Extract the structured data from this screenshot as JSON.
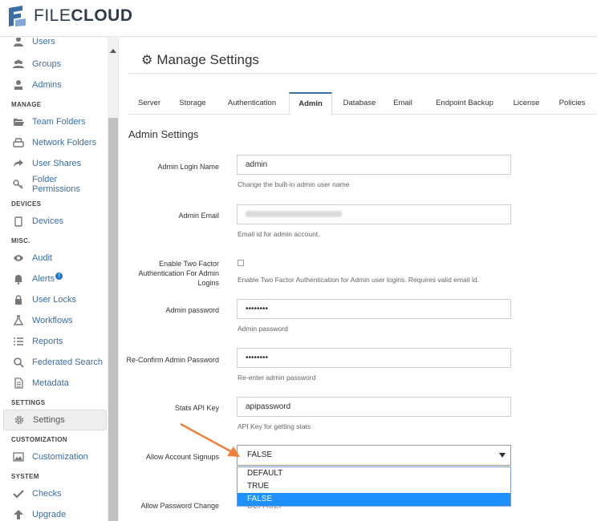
{
  "app": {
    "logo_text_light": "FILE",
    "logo_text_bold": "CLOUD",
    "brand_color": "#3a6ea5"
  },
  "sidebar": {
    "items": [
      {
        "label": "Users",
        "icon": "user-icon"
      },
      {
        "label": "Groups",
        "icon": "users-icon"
      },
      {
        "label": "Admins",
        "icon": "admin-icon"
      },
      {
        "label": "Team Folders",
        "icon": "folder-open-icon"
      },
      {
        "label": "Network Folders",
        "icon": "hdd-icon"
      },
      {
        "label": "User Shares",
        "icon": "share-icon"
      },
      {
        "label": "Folder Permissions",
        "icon": "key-icon"
      },
      {
        "label": "Devices",
        "icon": "device-icon"
      },
      {
        "label": "Audit",
        "icon": "eye-icon"
      },
      {
        "label": "Alerts",
        "icon": "bell-icon"
      },
      {
        "label": "User Locks",
        "icon": "lock-icon"
      },
      {
        "label": "Workflows",
        "icon": "flask-icon"
      },
      {
        "label": "Reports",
        "icon": "list-icon"
      },
      {
        "label": "Federated Search",
        "icon": "search-icon"
      },
      {
        "label": "Metadata",
        "icon": "file-icon"
      },
      {
        "label": "Settings",
        "icon": "gear-icon"
      },
      {
        "label": "Customization",
        "icon": "image-icon"
      },
      {
        "label": "Checks",
        "icon": "check-icon"
      },
      {
        "label": "Upgrade",
        "icon": "arrow-up-icon"
      }
    ],
    "headers": [
      "MANAGE",
      "DEVICES",
      "MISC.",
      "SETTINGS",
      "CUSTOMIZATION",
      "SYSTEM"
    ],
    "alerts_badge": "!"
  },
  "page": {
    "title": "Manage Settings",
    "section_title": "Admin Settings"
  },
  "tabs": [
    {
      "label": "Server"
    },
    {
      "label": "Storage"
    },
    {
      "label": "Authentication"
    },
    {
      "label": "Admin"
    },
    {
      "label": "Database"
    },
    {
      "label": "Email"
    },
    {
      "label": "Endpoint Backup"
    },
    {
      "label": "License"
    },
    {
      "label": "Policies"
    }
  ],
  "form": {
    "admin_login": {
      "label": "Admin Login Name",
      "value": "admin",
      "help": "Change the built-in admin user name"
    },
    "admin_email": {
      "label": "Admin Email",
      "help": "Email id for admin account."
    },
    "two_factor": {
      "label": "Enable Two Factor Authentication For Admin Logins",
      "checked": false,
      "help": "Enable Two Factor Authentication for Admin user logins. Requires valid email id."
    },
    "admin_password": {
      "label": "Admin password",
      "value": "••••••••",
      "help": "Admin password"
    },
    "confirm_password": {
      "label": "Re-Confirm Admin Password",
      "value": "••••••••",
      "help": "Re-enter admin password"
    },
    "stats_api_key": {
      "label": "Stats API Key",
      "value": "apipassword",
      "help": "API Key for getting stats"
    },
    "allow_signups": {
      "label": "Allow Account Signups",
      "value": "FALSE",
      "options": [
        "DEFAULT",
        "TRUE",
        "FALSE"
      ],
      "selected_index": 2
    },
    "allow_password_change": {
      "label": "Allow Password Change",
      "value": "DEFAULT"
    }
  },
  "colors": {
    "arrow": "#f0803c",
    "selected_option": "#1e90ff"
  }
}
